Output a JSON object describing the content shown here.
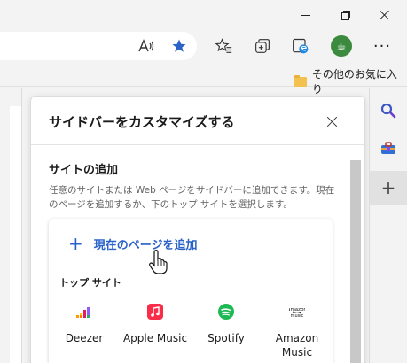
{
  "window": {
    "minimize": "minimize",
    "maximize": "maximize",
    "close": "close"
  },
  "toolbar": {
    "read_aloud_glyph": "A",
    "more_glyph": "···",
    "profile_glyph": "☕",
    "icons": [
      "read-aloud-icon",
      "star-icon",
      "favorites-icon",
      "collections-icon",
      "edge-bar-icon",
      "profile-icon",
      "more-icon"
    ],
    "accent_color": "#2a62c8"
  },
  "favorites_bar": {
    "folder_label": "その他のお気に入り"
  },
  "panel": {
    "title": "サイドバーをカスタマイズする",
    "section_title": "サイトの追加",
    "description": "任意のサイトまたは Web ページをサイドバーに追加できます。現在のページを追加するか、下のトップ サイトを選択します。",
    "add_page_label": "現在のページを追加",
    "add_page_glyph": "+",
    "top_sites_label": "トップ サイト",
    "top_sites": [
      {
        "label": "Deezer",
        "icon": "deezer-icon"
      },
      {
        "label": "Apple Music",
        "icon": "apple-music-icon"
      },
      {
        "label": "Spotify",
        "icon": "spotify-icon"
      },
      {
        "label": "Amazon Music",
        "icon": "amazon-music-icon"
      }
    ],
    "amazon_logo_text": "amazon music"
  },
  "sidebar": {
    "add_glyph": "+",
    "icons": [
      "search-icon",
      "tools-icon",
      "add-icon"
    ]
  }
}
